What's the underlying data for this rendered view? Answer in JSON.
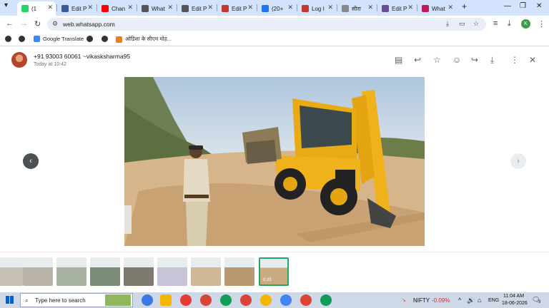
{
  "browser": {
    "tabs": [
      {
        "label": "(1",
        "color": "#25d366",
        "active": true
      },
      {
        "label": "Edit P",
        "color": "#3b5998"
      },
      {
        "label": "Chan",
        "color": "#ff0000"
      },
      {
        "label": "What",
        "color": "#555555"
      },
      {
        "label": "Edit P",
        "color": "#555555"
      },
      {
        "label": "Edit P",
        "color": "#c0392b"
      },
      {
        "label": "(20+",
        "color": "#1877f2"
      },
      {
        "label": "Log I",
        "color": "#c0392b"
      },
      {
        "label": "सीरा",
        "color": "#888888"
      },
      {
        "label": "Edit P",
        "color": "#6a4c93"
      },
      {
        "label": "What",
        "color": "#c2185b"
      }
    ],
    "new_tab": "+",
    "url": "web.whatsapp.com",
    "profile_initial": "K",
    "bookmarks": [
      "Google Translate",
      "ओडिशा के सीएम मोह..."
    ]
  },
  "viewer": {
    "sender": "+91 93003 60061 ~vikasksharma95",
    "time": "Today at 10:42",
    "icons": [
      "message-icon",
      "reply-icon",
      "star-icon",
      "emoji-icon",
      "forward-icon",
      "download-icon",
      "menu-icon",
      "close-icon"
    ]
  },
  "thumbnails": [
    {
      "kind": "photo",
      "tone": "#c9c1b4"
    },
    {
      "kind": "photo",
      "tone": "#b8b2a8"
    },
    {
      "kind": "photo",
      "tone": "#a9b3a4"
    },
    {
      "kind": "photo",
      "tone": "#7c8a78"
    },
    {
      "kind": "photo",
      "tone": "#7f7a70"
    },
    {
      "kind": "photo",
      "tone": "#c7c4d8"
    },
    {
      "kind": "photo",
      "tone": "#d0b894"
    },
    {
      "kind": "photo",
      "tone": "#b89a72"
    },
    {
      "kind": "video",
      "tone": "#c9ab82",
      "duration": "0:25",
      "selected": true
    }
  ],
  "taskbar": {
    "search_placeholder": "Type here to search",
    "stock": "NIFTY",
    "stock_change": "-0.09%",
    "lang": "ENG",
    "time": "11:04 AM",
    "date": "18-06-2026",
    "notification_count": "9"
  }
}
